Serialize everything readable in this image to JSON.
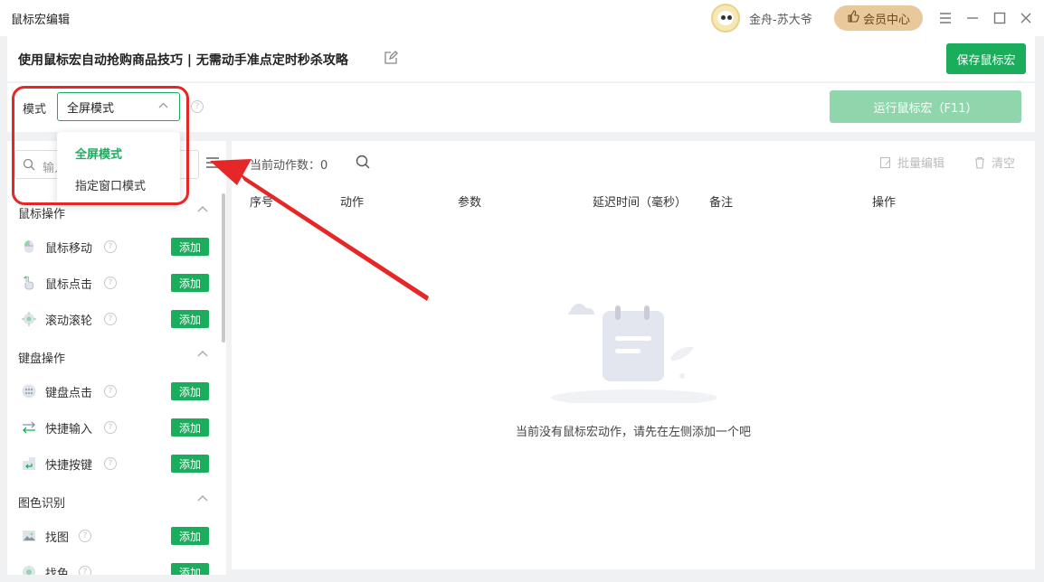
{
  "window": {
    "app_title": "鼠标宏编辑",
    "username": "金舟-苏大爷",
    "vip_label": "会员中心"
  },
  "header": {
    "title": "使用鼠标宏自动抢购商品技巧 | 无需动手准点定时秒杀攻略",
    "save_label": "保存鼠标宏"
  },
  "mode": {
    "label": "模式",
    "selected": "全屏模式",
    "options": [
      "全屏模式",
      "指定窗口模式"
    ],
    "run_label": "运行鼠标宏（F11）"
  },
  "sidebar": {
    "search_placeholder": "输入",
    "add_label": "添加",
    "sections": [
      {
        "title": "鼠标操作",
        "items": [
          "鼠标移动",
          "鼠标点击",
          "滚动滚轮"
        ]
      },
      {
        "title": "键盘操作",
        "items": [
          "键盘点击",
          "快捷输入",
          "快捷按键"
        ]
      },
      {
        "title": "图色识别",
        "items": [
          "找图",
          "找色"
        ]
      }
    ]
  },
  "main": {
    "count_label": "当前动作数：",
    "count_value": "0",
    "batch_edit": "批量编辑",
    "clear": "清空",
    "columns": [
      "序号",
      "动作",
      "参数",
      "延迟时间（毫秒）",
      "备注",
      "操作"
    ],
    "empty_text": "当前没有鼠标宏动作，请先在左侧添加一个吧"
  },
  "colors": {
    "accent": "#1aad5c",
    "annotation": "#e62727"
  }
}
